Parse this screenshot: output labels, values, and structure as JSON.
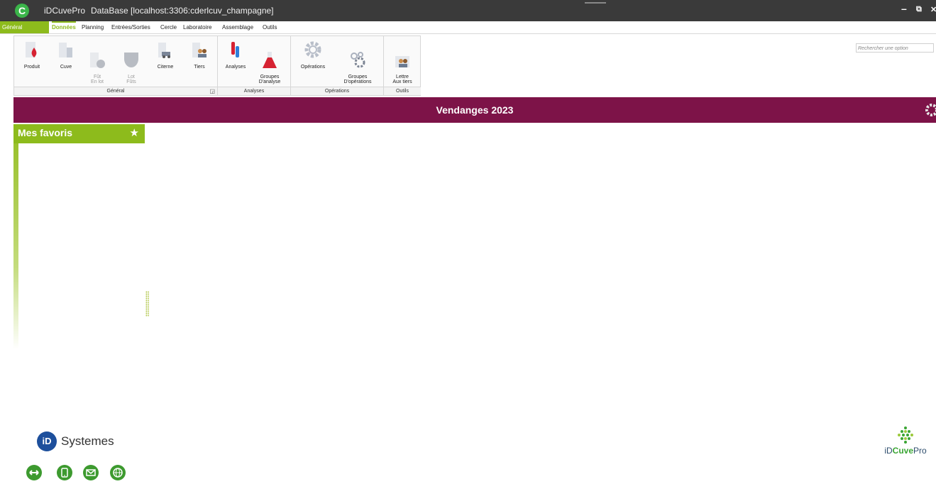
{
  "titlebar": {
    "app_logo": "C",
    "app_name": "iDCuvePro",
    "database": "DataBase [localhost:3306:cderlcuv_champagne]",
    "minimize": "–",
    "restore": "⧉",
    "close": "✕"
  },
  "menu": {
    "general": "Général",
    "items": [
      "Données",
      "Planning",
      "Entrées/Sorties",
      "Cercle",
      "Laboratoire",
      "Assemblage",
      "Outils"
    ],
    "active": "Données"
  },
  "search": {
    "placeholder": "Rechercher une option"
  },
  "ribbon": {
    "groups": [
      {
        "label": "Général",
        "buttons": [
          {
            "label": "Produit",
            "icon": "product-icon",
            "enabled": true
          },
          {
            "label": "Cuve",
            "icon": "tank-icon",
            "enabled": true
          },
          {
            "label": "Fût\nEn lot",
            "icon": "barrel-lot-icon",
            "enabled": false
          },
          {
            "label": "Lot\nFûts",
            "icon": "barrels-icon",
            "enabled": false
          },
          {
            "label": "Citerne",
            "icon": "truck-tank-icon",
            "enabled": true
          },
          {
            "label": "Tiers",
            "icon": "contacts-icon",
            "enabled": true
          }
        ]
      },
      {
        "label": "Analyses",
        "buttons": [
          {
            "label": "Analyses",
            "icon": "test-tubes-icon",
            "enabled": true
          },
          {
            "label": "Groupes\nD'analyse",
            "icon": "flask-icon",
            "enabled": true
          }
        ]
      },
      {
        "label": "Opérations",
        "buttons": [
          {
            "label": "Opérations",
            "icon": "gear-icon",
            "enabled": true
          },
          {
            "label": "Groupes\nD'opérations",
            "icon": "gears-icon",
            "enabled": true
          }
        ]
      },
      {
        "label": "Outils",
        "buttons": [
          {
            "label": "Lettre\nAux tiers",
            "icon": "letter-contacts-icon",
            "enabled": true
          }
        ]
      }
    ]
  },
  "banner": {
    "title": "Vendanges 2023"
  },
  "favorites": {
    "title": "Mes favoris"
  },
  "footer": {
    "left_logo_mark": "iD",
    "left_logo_text": "Systemes",
    "right_logo_prefix": "iD",
    "right_logo_bold": "Cuve",
    "right_logo_suffix": "Pro",
    "buttons": [
      "swap-icon",
      "phone-icon",
      "mail-icon",
      "globe-icon"
    ]
  },
  "colors": {
    "accent_green": "#8dbb1c",
    "banner": "#7d1348",
    "titlebar": "#3a3a3a"
  }
}
